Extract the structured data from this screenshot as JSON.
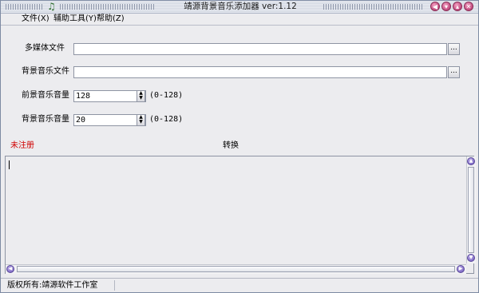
{
  "window": {
    "title": "靖源背景音乐添加器 ver:1.12",
    "buttons": {
      "restore": "◀",
      "minimize": "▾",
      "maximize": "▴",
      "close": "✕"
    }
  },
  "menu": {
    "items": [
      {
        "label": "文件(X)"
      },
      {
        "label": "辅助工具(Y)"
      },
      {
        "label": "帮助(Z)"
      }
    ]
  },
  "form": {
    "media_label": "多媒体文件",
    "media_value": "",
    "bgm_label": "背景音乐文件",
    "bgm_value": "",
    "browse_label": "...",
    "fg_volume_label": "前景音乐音量",
    "fg_volume_value": "128",
    "fg_range": "(0-128)",
    "bg_volume_label": "背景音乐音量",
    "bg_volume_value": "20",
    "bg_range": "(0-128)",
    "unregistered": "未注册",
    "convert": "转换"
  },
  "log": {
    "content": ""
  },
  "status": {
    "copyright": "版权所有:靖源软件工作室"
  },
  "colors": {
    "title_bg": "#dde1ea",
    "accent_red": "#d00000",
    "scroll_button": "#7f6bc5"
  }
}
